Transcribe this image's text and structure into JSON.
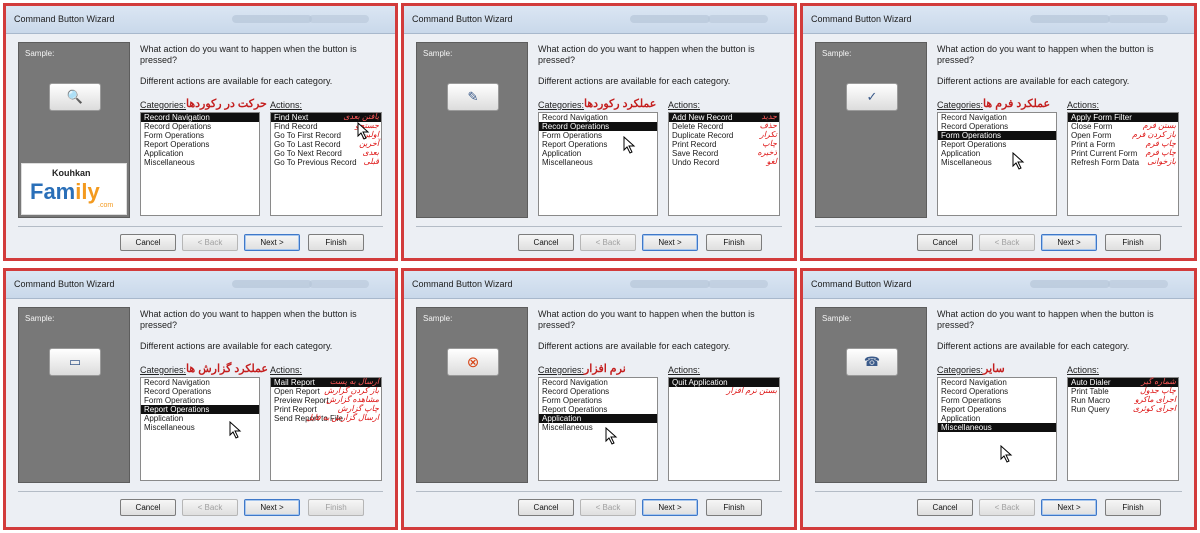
{
  "window_title": "Command Button Wizard",
  "question": "What action do you want to happen when the button is pressed?",
  "info": "Different actions are available for each category.",
  "sample_label": "Sample:",
  "categories_label": "Categories:",
  "actions_label": "Actions:",
  "buttons": {
    "cancel": "Cancel",
    "back": "< Back",
    "next": "Next >",
    "finish": "Finish"
  },
  "logo": {
    "brand_top": "Kouhkan",
    "brand_main_a": "Fam",
    "brand_main_b": "ily",
    "brand_tld": ".com"
  },
  "panels": [
    {
      "sample_icon": "🔍",
      "category_annotation": "حرکت در رکوردها",
      "categories": [
        {
          "text": "Record Navigation",
          "selected": true
        },
        {
          "text": "Record Operations",
          "selected": false
        },
        {
          "text": "Form Operations",
          "selected": false
        },
        {
          "text": "Report Operations",
          "selected": false
        },
        {
          "text": "Application",
          "selected": false
        },
        {
          "text": "Miscellaneous",
          "selected": false
        }
      ],
      "actions": [
        {
          "text": "Find Next",
          "note": "یافتن بعدی",
          "selected": true
        },
        {
          "text": "Find Record",
          "note": "جستجو",
          "selected": false
        },
        {
          "text": "Go To First Record",
          "note": "اولین",
          "selected": false
        },
        {
          "text": "Go To Last Record",
          "note": "آخرین",
          "selected": false
        },
        {
          "text": "Go To Next Record",
          "note": "بعدی",
          "selected": false
        },
        {
          "text": "Go To Previous Record",
          "note": "قبلی",
          "selected": false
        }
      ]
    },
    {
      "sample_icon": "✎",
      "category_annotation": "عملکرد رکوردها",
      "categories": [
        {
          "text": "Record Navigation",
          "selected": false
        },
        {
          "text": "Record Operations",
          "selected": true
        },
        {
          "text": "Form Operations",
          "selected": false
        },
        {
          "text": "Report Operations",
          "selected": false
        },
        {
          "text": "Application",
          "selected": false
        },
        {
          "text": "Miscellaneous",
          "selected": false
        }
      ],
      "actions": [
        {
          "text": "Add New Record",
          "note": "جدید",
          "selected": true
        },
        {
          "text": "Delete Record",
          "note": "حذف",
          "selected": false
        },
        {
          "text": "Duplicate Record",
          "note": "تکرار",
          "selected": false
        },
        {
          "text": "Print Record",
          "note": "چاپ",
          "selected": false
        },
        {
          "text": "Save Record",
          "note": "ذخیره",
          "selected": false
        },
        {
          "text": "Undo Record",
          "note": "لغو",
          "selected": false
        }
      ]
    },
    {
      "sample_icon": "✓",
      "category_annotation": "عملکرد فرم ها",
      "categories": [
        {
          "text": "Record Navigation",
          "selected": false
        },
        {
          "text": "Record Operations",
          "selected": false
        },
        {
          "text": "Form Operations",
          "selected": true
        },
        {
          "text": "Report Operations",
          "selected": false
        },
        {
          "text": "Application",
          "selected": false
        },
        {
          "text": "Miscellaneous",
          "selected": false
        }
      ],
      "actions": [
        {
          "text": "Apply Form Filter",
          "note": "",
          "selected": true
        },
        {
          "text": "Close Form",
          "note": "بستن فرم",
          "selected": false
        },
        {
          "text": "Open Form",
          "note": "باز کردن فرم",
          "selected": false
        },
        {
          "text": "Print a Form",
          "note": "چاپ فرم",
          "selected": false
        },
        {
          "text": "Print Current Form",
          "note": "چاپ فرم",
          "selected": false
        },
        {
          "text": "Refresh Form Data",
          "note": "بازخوانی",
          "selected": false
        }
      ]
    },
    {
      "sample_icon": "▭",
      "category_annotation": "عملکرد گزارش ها",
      "categories": [
        {
          "text": "Record Navigation",
          "selected": false
        },
        {
          "text": "Record Operations",
          "selected": false
        },
        {
          "text": "Form Operations",
          "selected": false
        },
        {
          "text": "Report Operations",
          "selected": true
        },
        {
          "text": "Application",
          "selected": false
        },
        {
          "text": "Miscellaneous",
          "selected": false
        }
      ],
      "actions": [
        {
          "text": "Mail Report",
          "note": "ارسال به پست",
          "selected": true
        },
        {
          "text": "Open Report",
          "note": "باز کردن گزارش",
          "selected": false
        },
        {
          "text": "Preview Report",
          "note": "مشاهده گزارش",
          "selected": false
        },
        {
          "text": "Print Report",
          "note": "چاپ گزارش",
          "selected": false
        },
        {
          "text": "Send Report to File",
          "note": "ارسال گزارش به فایل",
          "selected": false
        }
      ]
    },
    {
      "sample_icon": "⊗",
      "category_annotation": "نرم افزار",
      "categories": [
        {
          "text": "Record Navigation",
          "selected": false
        },
        {
          "text": "Record Operations",
          "selected": false
        },
        {
          "text": "Form Operations",
          "selected": false
        },
        {
          "text": "Report Operations",
          "selected": false
        },
        {
          "text": "Application",
          "selected": true
        },
        {
          "text": "Miscellaneous",
          "selected": false
        }
      ],
      "actions": [
        {
          "text": "Quit Application",
          "note": "",
          "selected": true
        },
        {
          "text": "",
          "note": "بستن نرم افزار",
          "selected": false
        }
      ]
    },
    {
      "sample_icon": "☎",
      "category_annotation": "سایر",
      "categories": [
        {
          "text": "Record Navigation",
          "selected": false
        },
        {
          "text": "Record Operations",
          "selected": false
        },
        {
          "text": "Form Operations",
          "selected": false
        },
        {
          "text": "Report Operations",
          "selected": false
        },
        {
          "text": "Application",
          "selected": false
        },
        {
          "text": "Miscellaneous",
          "selected": true
        }
      ],
      "actions": [
        {
          "text": "Auto Dialer",
          "note": "شماره گیر",
          "selected": true
        },
        {
          "text": "Print Table",
          "note": "چاپ جدول",
          "selected": false
        },
        {
          "text": "Run Macro",
          "note": "اجرای ماکرو",
          "selected": false
        },
        {
          "text": "Run Query",
          "note": "اجرای کوئری",
          "selected": false
        }
      ]
    }
  ]
}
